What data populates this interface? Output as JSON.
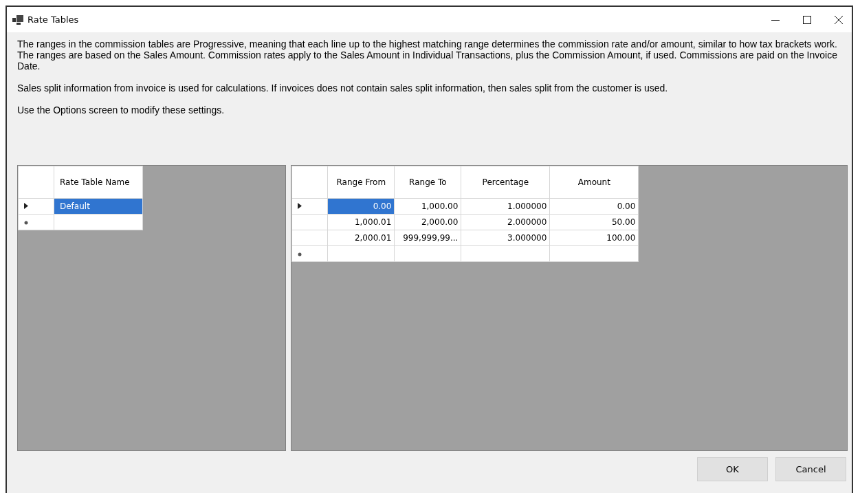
{
  "window": {
    "title": "Rate Tables"
  },
  "description": [
    "The ranges in the commission tables are Progressive, meaning that each line up to the highest matching range determines the commission rate and/or amount, similar to how tax brackets work. The ranges are based on the Sales Amount. Commission rates apply to the Sales Amount in Individual Transactions, plus the Commission Amount, if used. Commissions are paid on the Invoice Date.",
    "Sales split information from invoice is used for calculations. If invoices does not contain sales split information, then sales split from the customer is used.",
    "Use the Options screen to modify these settings."
  ],
  "rate_tables": {
    "columns": [
      "Rate Table Name"
    ],
    "rows": [
      {
        "kind": "current",
        "cells": [
          {
            "text": "Default",
            "selected": true
          }
        ]
      },
      {
        "kind": "new",
        "cells": [
          {
            "text": "",
            "selected": false
          }
        ]
      }
    ]
  },
  "ranges": {
    "columns": [
      "Range From",
      "Range To",
      "Percentage",
      "Amount"
    ],
    "rows": [
      {
        "kind": "current",
        "cells": [
          {
            "text": "0.00",
            "selected": true
          },
          {
            "text": "1,000.00",
            "selected": false
          },
          {
            "text": "1.000000",
            "selected": false
          },
          {
            "text": "0.00",
            "selected": false
          }
        ]
      },
      {
        "kind": "none",
        "cells": [
          {
            "text": "1,000.01",
            "selected": false
          },
          {
            "text": "2,000.00",
            "selected": false
          },
          {
            "text": "2.000000",
            "selected": false
          },
          {
            "text": "50.00",
            "selected": false
          }
        ]
      },
      {
        "kind": "none",
        "cells": [
          {
            "text": "2,000.01",
            "selected": false
          },
          {
            "text": "999,999,99...",
            "selected": false
          },
          {
            "text": "3.000000",
            "selected": false
          },
          {
            "text": "100.00",
            "selected": false
          }
        ]
      },
      {
        "kind": "new",
        "cells": [
          {
            "text": "",
            "selected": false
          },
          {
            "text": "",
            "selected": false
          },
          {
            "text": "",
            "selected": false
          },
          {
            "text": "",
            "selected": false
          }
        ]
      }
    ]
  },
  "buttons": [
    "OK",
    "Cancel"
  ]
}
